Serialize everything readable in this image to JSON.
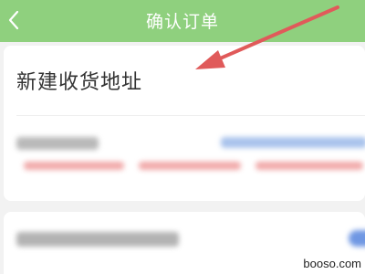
{
  "header": {
    "title": "确认订单",
    "back_icon": "chevron-left-icon",
    "background": "#8fd07e"
  },
  "address_card": {
    "new_address_label": "新建收货地址"
  },
  "annotation": {
    "arrow_color": "#e05a5a",
    "arrow_icon": "red-arrow"
  },
  "watermark": {
    "text": "booso.com"
  }
}
